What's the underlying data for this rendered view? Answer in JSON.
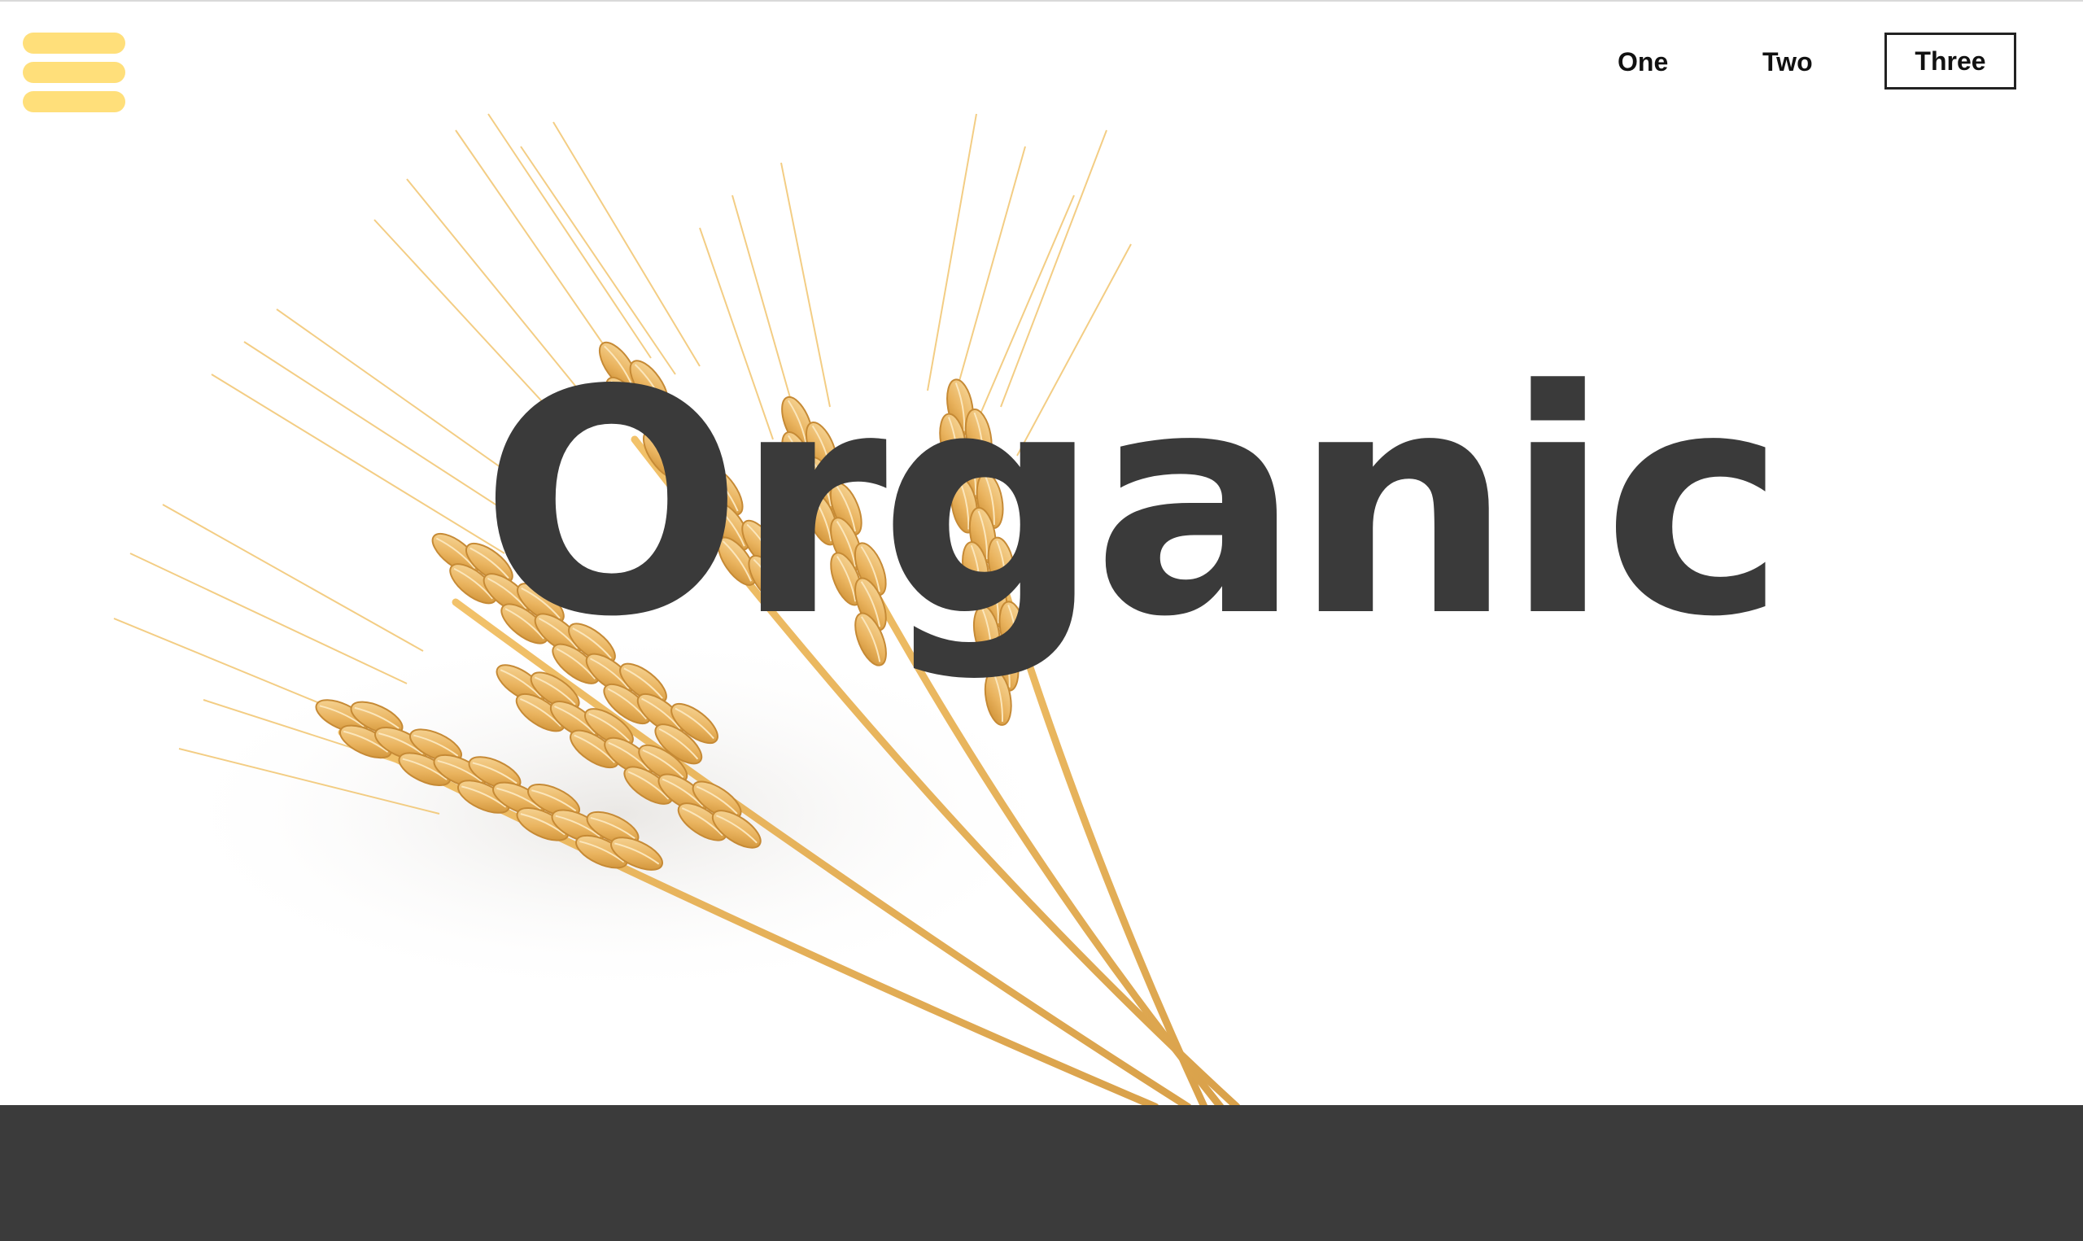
{
  "header": {
    "menu_icon": "hamburger-menu-icon",
    "menu_color": "#ffdf7a",
    "nav": {
      "items": [
        {
          "label": "One",
          "style": "plain"
        },
        {
          "label": "Two",
          "style": "plain"
        },
        {
          "label": "Three",
          "style": "outlined"
        }
      ]
    }
  },
  "hero": {
    "title": "Organic",
    "title_color": "#3a3a3a",
    "image": "wheat-sheaf-illustration"
  },
  "footer": {
    "band_color": "#3b3b3b"
  }
}
